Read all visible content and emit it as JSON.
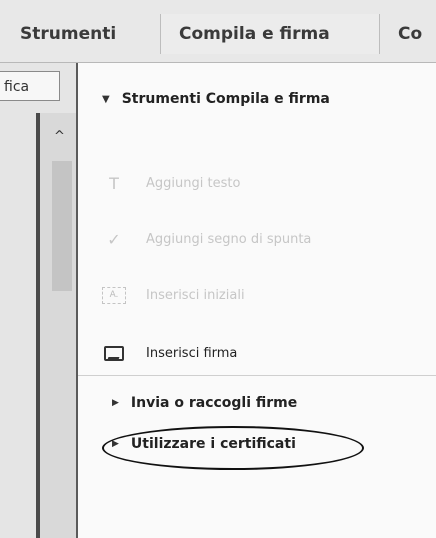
{
  "tabs": [
    {
      "label": "Strumenti"
    },
    {
      "label": "Compila e firma"
    },
    {
      "label": "Co"
    }
  ],
  "left": {
    "button_label": "fica",
    "scroll_up_glyph": "^"
  },
  "panel": {
    "section_title": "Strumenti Compila e firma",
    "items": [
      {
        "label": "Aggiungi testo",
        "icon": "text-icon"
      },
      {
        "label": "Aggiungi segno di spunta",
        "icon": "checkmark-icon"
      },
      {
        "label": "Inserisci iniziali",
        "icon": "initials-icon"
      },
      {
        "label": "Inserisci firma",
        "icon": "signature-icon"
      }
    ],
    "subsections": [
      {
        "label": "Invia o raccogli firme"
      },
      {
        "label": "Utilizzare i certificati"
      }
    ]
  }
}
